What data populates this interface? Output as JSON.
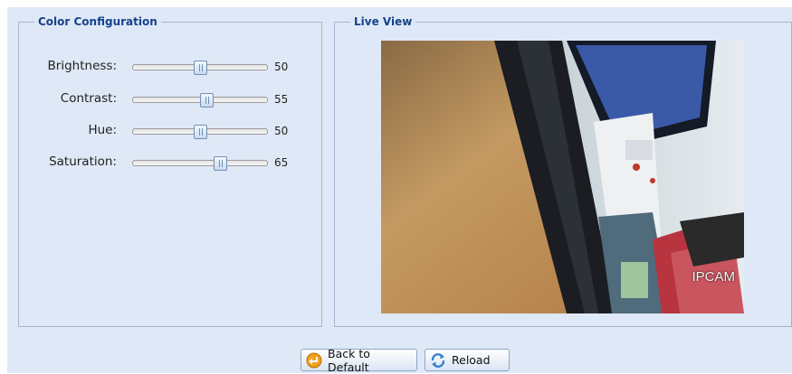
{
  "color_config": {
    "legend": "Color Configuration",
    "sliders": [
      {
        "label": "Brightness:",
        "value": "50",
        "level": 50
      },
      {
        "label": "Contrast:",
        "value": "55",
        "level": 55
      },
      {
        "label": "Hue:",
        "value": "50",
        "level": 50
      },
      {
        "label": "Saturation:",
        "value": "65",
        "level": 65
      }
    ]
  },
  "live_view": {
    "legend": "Live View",
    "osd_text": "IPCAM"
  },
  "buttons": {
    "back_to_default": "Back to Default",
    "reload": "Reload"
  },
  "icons": {
    "back_to_default": "orange-back-arrow-icon",
    "reload": "blue-refresh-icon"
  },
  "colors": {
    "panel_bg": "#dfe8f6",
    "legend_text": "#15428b",
    "fieldset_border": "#a3b6cf"
  }
}
